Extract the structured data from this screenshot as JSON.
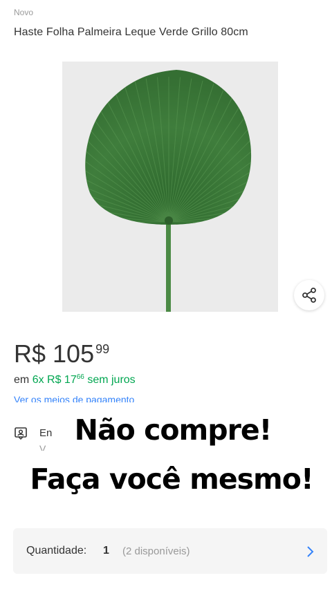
{
  "condition": "Novo",
  "title": "Haste Folha Palmeira Leque Verde Grillo 80cm",
  "product_image": {
    "subject": "palm-fan-leaf",
    "background_color": "#ebebeb",
    "leaf_color": "#3e7a3b"
  },
  "share": {
    "icon": "share-icon"
  },
  "price": {
    "currency": "R$",
    "integer": "105",
    "cents": "99"
  },
  "installments": {
    "prefix": "em",
    "count": "6x R$ 17",
    "cents": "66",
    "suffix": "sem juros",
    "color": "#00a650"
  },
  "payment_link": "Ver os meios de pagamento",
  "shipping": {
    "icon": "store-pickup-icon",
    "text": "En",
    "sub": "V"
  },
  "overlay": {
    "line1": "Não compre!",
    "line2": "Faça você mesmo!"
  },
  "quantity": {
    "label": "Quantidade:",
    "value": "1",
    "available": "(2 disponíveis)",
    "icon": "chevron-right-icon"
  },
  "colors": {
    "link": "#3483fa",
    "green": "#00a650",
    "text": "#333333",
    "muted": "#999999"
  }
}
